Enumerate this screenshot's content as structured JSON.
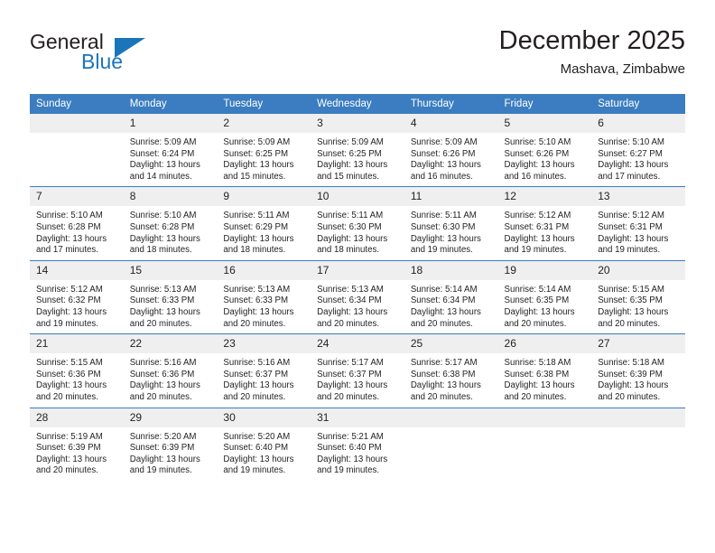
{
  "branding": {
    "name_top": "General",
    "name_bottom": "Blue",
    "accent_color": "#1b75bb"
  },
  "header": {
    "title": "December 2025",
    "subtitle": "Mashava, Zimbabwe"
  },
  "calendar": {
    "header_bg": "#3b7dc0",
    "daynum_bg": "#efefef",
    "weekday_headers": [
      "Sunday",
      "Monday",
      "Tuesday",
      "Wednesday",
      "Thursday",
      "Friday",
      "Saturday"
    ],
    "weeks": [
      [
        {
          "day": "",
          "lines": []
        },
        {
          "day": "1",
          "lines": [
            "Sunrise: 5:09 AM",
            "Sunset: 6:24 PM",
            "Daylight: 13 hours",
            "and 14 minutes."
          ]
        },
        {
          "day": "2",
          "lines": [
            "Sunrise: 5:09 AM",
            "Sunset: 6:25 PM",
            "Daylight: 13 hours",
            "and 15 minutes."
          ]
        },
        {
          "day": "3",
          "lines": [
            "Sunrise: 5:09 AM",
            "Sunset: 6:25 PM",
            "Daylight: 13 hours",
            "and 15 minutes."
          ]
        },
        {
          "day": "4",
          "lines": [
            "Sunrise: 5:09 AM",
            "Sunset: 6:26 PM",
            "Daylight: 13 hours",
            "and 16 minutes."
          ]
        },
        {
          "day": "5",
          "lines": [
            "Sunrise: 5:10 AM",
            "Sunset: 6:26 PM",
            "Daylight: 13 hours",
            "and 16 minutes."
          ]
        },
        {
          "day": "6",
          "lines": [
            "Sunrise: 5:10 AM",
            "Sunset: 6:27 PM",
            "Daylight: 13 hours",
            "and 17 minutes."
          ]
        }
      ],
      [
        {
          "day": "7",
          "lines": [
            "Sunrise: 5:10 AM",
            "Sunset: 6:28 PM",
            "Daylight: 13 hours",
            "and 17 minutes."
          ]
        },
        {
          "day": "8",
          "lines": [
            "Sunrise: 5:10 AM",
            "Sunset: 6:28 PM",
            "Daylight: 13 hours",
            "and 18 minutes."
          ]
        },
        {
          "day": "9",
          "lines": [
            "Sunrise: 5:11 AM",
            "Sunset: 6:29 PM",
            "Daylight: 13 hours",
            "and 18 minutes."
          ]
        },
        {
          "day": "10",
          "lines": [
            "Sunrise: 5:11 AM",
            "Sunset: 6:30 PM",
            "Daylight: 13 hours",
            "and 18 minutes."
          ]
        },
        {
          "day": "11",
          "lines": [
            "Sunrise: 5:11 AM",
            "Sunset: 6:30 PM",
            "Daylight: 13 hours",
            "and 19 minutes."
          ]
        },
        {
          "day": "12",
          "lines": [
            "Sunrise: 5:12 AM",
            "Sunset: 6:31 PM",
            "Daylight: 13 hours",
            "and 19 minutes."
          ]
        },
        {
          "day": "13",
          "lines": [
            "Sunrise: 5:12 AM",
            "Sunset: 6:31 PM",
            "Daylight: 13 hours",
            "and 19 minutes."
          ]
        }
      ],
      [
        {
          "day": "14",
          "lines": [
            "Sunrise: 5:12 AM",
            "Sunset: 6:32 PM",
            "Daylight: 13 hours",
            "and 19 minutes."
          ]
        },
        {
          "day": "15",
          "lines": [
            "Sunrise: 5:13 AM",
            "Sunset: 6:33 PM",
            "Daylight: 13 hours",
            "and 20 minutes."
          ]
        },
        {
          "day": "16",
          "lines": [
            "Sunrise: 5:13 AM",
            "Sunset: 6:33 PM",
            "Daylight: 13 hours",
            "and 20 minutes."
          ]
        },
        {
          "day": "17",
          "lines": [
            "Sunrise: 5:13 AM",
            "Sunset: 6:34 PM",
            "Daylight: 13 hours",
            "and 20 minutes."
          ]
        },
        {
          "day": "18",
          "lines": [
            "Sunrise: 5:14 AM",
            "Sunset: 6:34 PM",
            "Daylight: 13 hours",
            "and 20 minutes."
          ]
        },
        {
          "day": "19",
          "lines": [
            "Sunrise: 5:14 AM",
            "Sunset: 6:35 PM",
            "Daylight: 13 hours",
            "and 20 minutes."
          ]
        },
        {
          "day": "20",
          "lines": [
            "Sunrise: 5:15 AM",
            "Sunset: 6:35 PM",
            "Daylight: 13 hours",
            "and 20 minutes."
          ]
        }
      ],
      [
        {
          "day": "21",
          "lines": [
            "Sunrise: 5:15 AM",
            "Sunset: 6:36 PM",
            "Daylight: 13 hours",
            "and 20 minutes."
          ]
        },
        {
          "day": "22",
          "lines": [
            "Sunrise: 5:16 AM",
            "Sunset: 6:36 PM",
            "Daylight: 13 hours",
            "and 20 minutes."
          ]
        },
        {
          "day": "23",
          "lines": [
            "Sunrise: 5:16 AM",
            "Sunset: 6:37 PM",
            "Daylight: 13 hours",
            "and 20 minutes."
          ]
        },
        {
          "day": "24",
          "lines": [
            "Sunrise: 5:17 AM",
            "Sunset: 6:37 PM",
            "Daylight: 13 hours",
            "and 20 minutes."
          ]
        },
        {
          "day": "25",
          "lines": [
            "Sunrise: 5:17 AM",
            "Sunset: 6:38 PM",
            "Daylight: 13 hours",
            "and 20 minutes."
          ]
        },
        {
          "day": "26",
          "lines": [
            "Sunrise: 5:18 AM",
            "Sunset: 6:38 PM",
            "Daylight: 13 hours",
            "and 20 minutes."
          ]
        },
        {
          "day": "27",
          "lines": [
            "Sunrise: 5:18 AM",
            "Sunset: 6:39 PM",
            "Daylight: 13 hours",
            "and 20 minutes."
          ]
        }
      ],
      [
        {
          "day": "28",
          "lines": [
            "Sunrise: 5:19 AM",
            "Sunset: 6:39 PM",
            "Daylight: 13 hours",
            "and 20 minutes."
          ]
        },
        {
          "day": "29",
          "lines": [
            "Sunrise: 5:20 AM",
            "Sunset: 6:39 PM",
            "Daylight: 13 hours",
            "and 19 minutes."
          ]
        },
        {
          "day": "30",
          "lines": [
            "Sunrise: 5:20 AM",
            "Sunset: 6:40 PM",
            "Daylight: 13 hours",
            "and 19 minutes."
          ]
        },
        {
          "day": "31",
          "lines": [
            "Sunrise: 5:21 AM",
            "Sunset: 6:40 PM",
            "Daylight: 13 hours",
            "and 19 minutes."
          ]
        },
        {
          "day": "",
          "lines": []
        },
        {
          "day": "",
          "lines": []
        },
        {
          "day": "",
          "lines": []
        }
      ]
    ]
  }
}
